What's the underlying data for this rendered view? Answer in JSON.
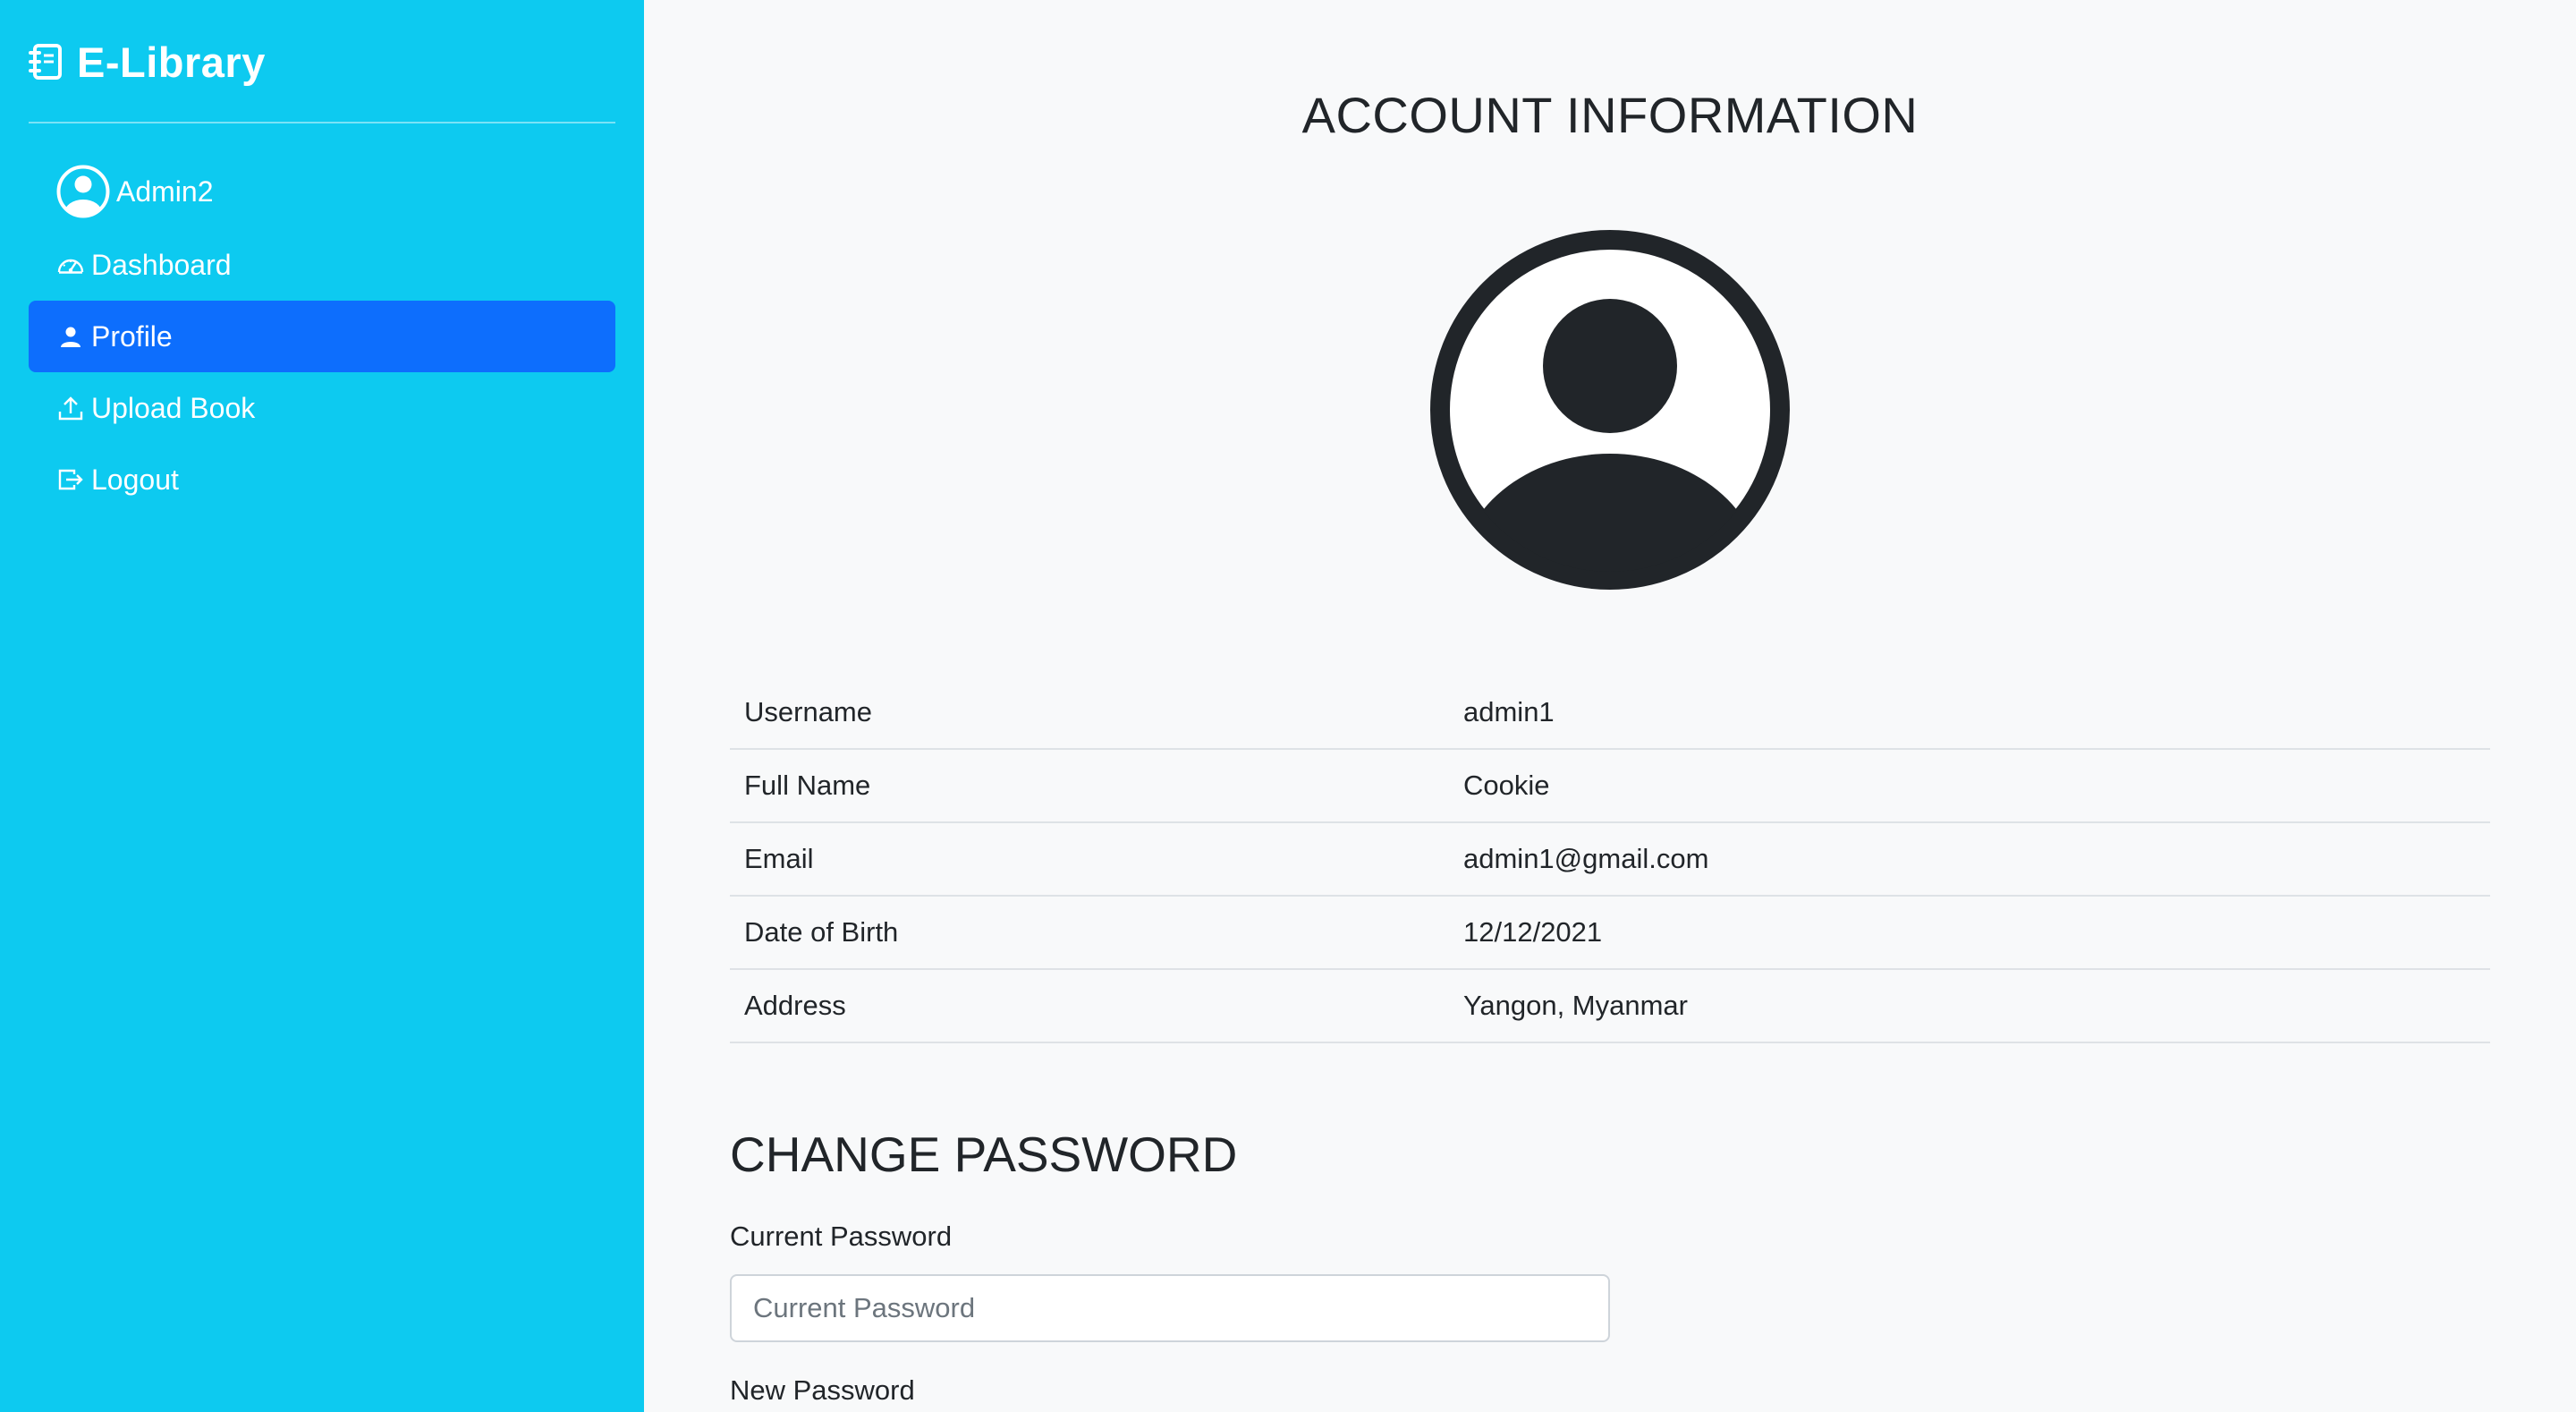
{
  "sidebar": {
    "brand": "E-Library",
    "user": "Admin2",
    "items": [
      {
        "label": "Dashboard",
        "icon": "speedometer-icon"
      },
      {
        "label": "Profile",
        "icon": "person-icon",
        "active": true
      },
      {
        "label": "Upload Book",
        "icon": "upload-icon"
      },
      {
        "label": "Logout",
        "icon": "logout-icon"
      }
    ]
  },
  "main": {
    "title": "ACCOUNT INFORMATION",
    "info": [
      {
        "label": "Username",
        "value": "admin1"
      },
      {
        "label": "Full Name",
        "value": "Cookie"
      },
      {
        "label": "Email",
        "value": "admin1@gmail.com"
      },
      {
        "label": "Date of Birth",
        "value": "12/12/2021"
      },
      {
        "label": "Address",
        "value": "Yangon, Myanmar"
      }
    ],
    "change_password": {
      "title": "CHANGE PASSWORD",
      "current_label": "Current Password",
      "current_placeholder": "Current Password",
      "new_label": "New Password"
    }
  },
  "colors": {
    "sidebar_bg": "#0dcaf0",
    "active_bg": "#0d6efd",
    "page_bg": "#f8f9fa",
    "text": "#212529"
  }
}
